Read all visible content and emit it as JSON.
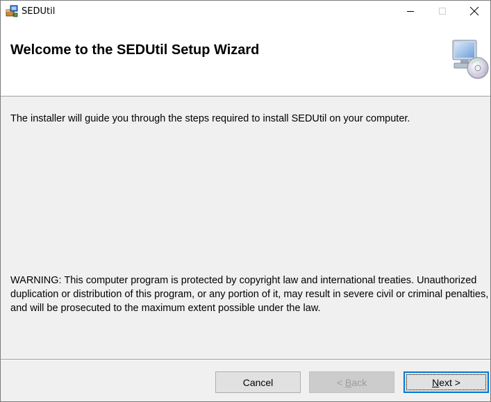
{
  "window": {
    "title": "SEDUtil",
    "icons": {
      "app": "installer-box-icon",
      "minimize": "minimize-icon",
      "maximize": "maximize-icon",
      "close": "close-icon"
    }
  },
  "header": {
    "title": "Welcome to the SEDUtil Setup Wizard",
    "logo_icon": "computer-cd-icon"
  },
  "body": {
    "intro": "The installer will guide you through the steps required to install SEDUtil on your computer.",
    "warning": "WARNING: This computer program is protected by copyright law and international treaties. Unauthorized duplication or distribution of this program, or any portion of it, may result in severe civil or criminal penalties, and will be prosecuted to the maximum extent possible under the law."
  },
  "buttons": {
    "cancel": "Cancel",
    "back_prefix": "< ",
    "back_accel": "B",
    "back_rest": "ack",
    "next_accel": "N",
    "next_rest": "ext >"
  },
  "colors": {
    "dialog_bg": "#f0f0f0",
    "header_bg": "#ffffff",
    "focus_border": "#0078d7",
    "disabled_text": "#9d9d9d"
  }
}
